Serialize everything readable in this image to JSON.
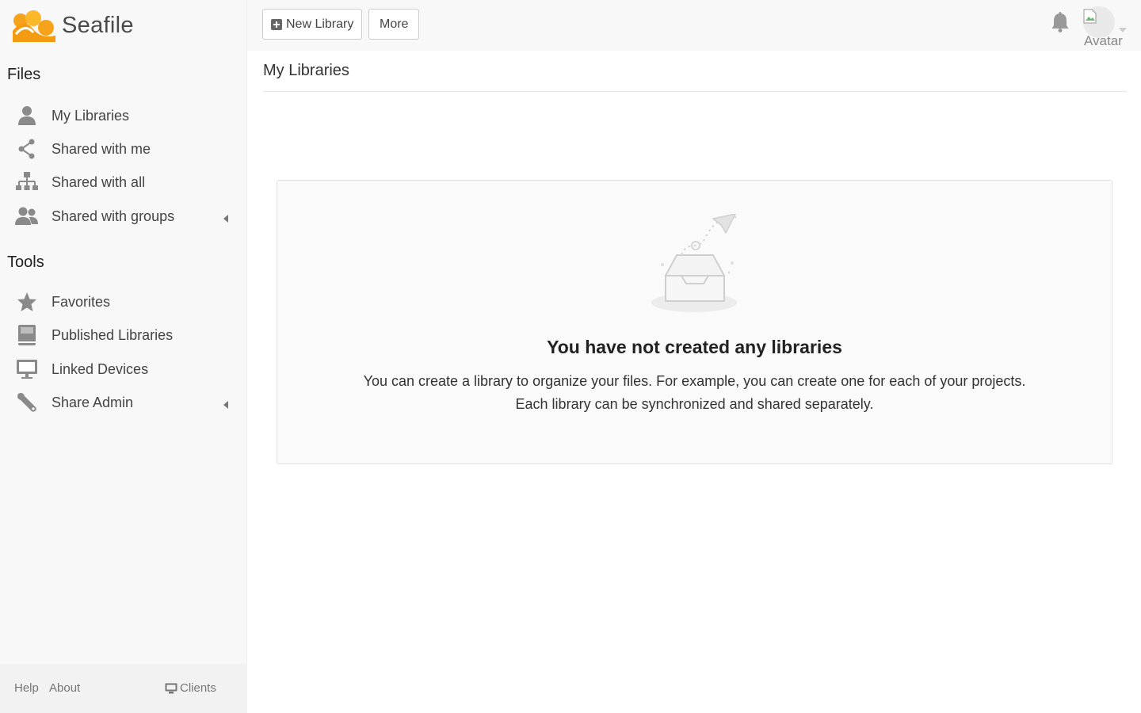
{
  "app": {
    "name": "Seafile",
    "brand_color": "#f7a21b"
  },
  "sidebar": {
    "sections": [
      {
        "heading": "Files",
        "items": [
          {
            "label": "My Libraries",
            "icon": "user-icon"
          },
          {
            "label": "Shared with me",
            "icon": "share-icon"
          },
          {
            "label": "Shared with all",
            "icon": "sitemap-icon"
          },
          {
            "label": "Shared with groups",
            "icon": "group-icon",
            "expandable": true
          }
        ]
      },
      {
        "heading": "Tools",
        "items": [
          {
            "label": "Favorites",
            "icon": "star-icon"
          },
          {
            "label": "Published Libraries",
            "icon": "book-icon"
          },
          {
            "label": "Linked Devices",
            "icon": "monitor-icon"
          },
          {
            "label": "Share Admin",
            "icon": "wrench-icon",
            "expandable": true
          }
        ]
      }
    ],
    "footer": {
      "help": "Help",
      "about": "About",
      "clients": "Clients"
    }
  },
  "toolbar": {
    "new_library": "New Library",
    "more": "More"
  },
  "header": {
    "avatar_alt": "Avatar"
  },
  "main": {
    "title": "My Libraries",
    "empty": {
      "title": "You have not created any libraries",
      "line1": "You can create a library to organize your files. For example, you can create one for each of your projects.",
      "line2": "Each library can be synchronized and shared separately."
    }
  }
}
